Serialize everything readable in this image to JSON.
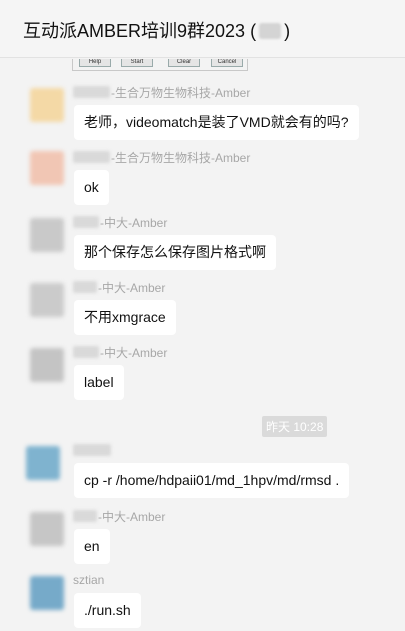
{
  "header": {
    "title": "互动派AMBER培训9群2023 (",
    "title_end": ")"
  },
  "screenshot_buttons": [
    "Help",
    "Start",
    "Clear",
    "Cancel"
  ],
  "time_divider": "昨天 10:28",
  "messages": [
    {
      "sender": "-生合万物生物科技-Amber",
      "text": "老师，videomatch是装了VMD就会有的吗?"
    },
    {
      "sender": "-生合万物生物科技-Amber",
      "text": "ok"
    },
    {
      "sender": "-中大-Amber",
      "text": "那个保存怎么保存图片格式啊"
    },
    {
      "sender": "-中大-Amber",
      "text": "不用xmgrace"
    },
    {
      "sender": "-中大-Amber",
      "text": "label"
    },
    {
      "sender": "",
      "text": "cp -r /home/hdpaii01/md_1hpv/md/rmsd  ."
    },
    {
      "sender": "-中大-Amber",
      "text": "en"
    },
    {
      "sender": "sztian",
      "text": "./run.sh"
    }
  ],
  "colors": {
    "bubble": "#ffffff",
    "background": "#f3f3f3",
    "name": "#a7a7a7",
    "avatar_1": "#f4d9a6",
    "avatar_2": "#f1c6b4",
    "avatar_gray": "#c9c9c9",
    "avatar_blue": "#7fb3cf"
  }
}
